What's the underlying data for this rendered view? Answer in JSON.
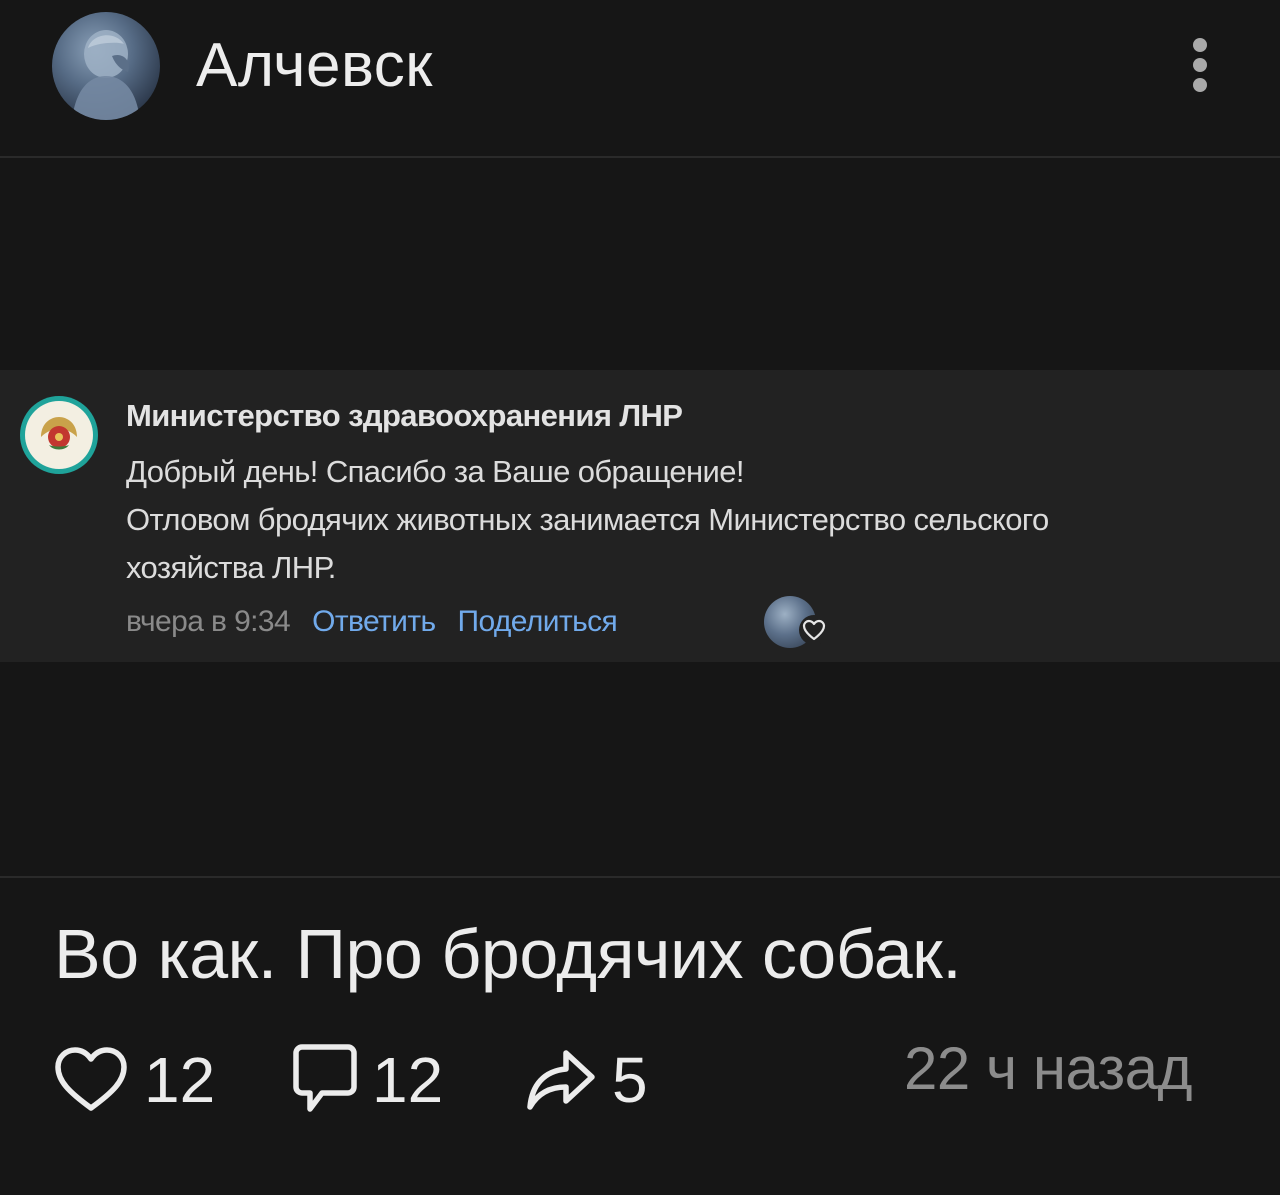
{
  "header": {
    "title": "Алчевск",
    "avatar_icon": "community-avatar-icon",
    "more_icon": "more-vertical-icon"
  },
  "comment": {
    "author": "Министерство здравоохранения ЛНР",
    "lines": [
      "Добрый день! Спасибо за Ваше обращение!",
      "Отловом бродячих животных занимается Министерство сельского",
      "хозяйства ЛНР."
    ],
    "time": "вчера в 9:34",
    "reply_label": "Ответить",
    "share_label": "Поделиться",
    "avatar_icon": "ministry-emblem-icon",
    "like_icon": "liked-by-author-icon"
  },
  "post": {
    "text": "Во как. Про бродячих собак.",
    "likes": "12",
    "comments": "12",
    "shares": "5",
    "time_ago": "22 ч назад"
  },
  "colors": {
    "background": "#161616",
    "card": "#222222",
    "link": "#71aaeb",
    "muted": "#8a8a8a",
    "emblem_ring": "#1fa39a"
  }
}
